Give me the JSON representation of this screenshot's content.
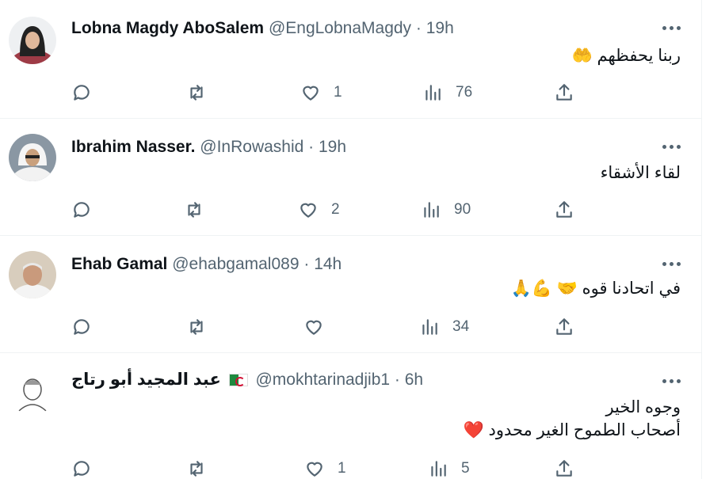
{
  "tweets": [
    {
      "name": "Lobna Magdy AboSalem",
      "handle": "@EngLobnaMagdy",
      "time": "19h",
      "text": "ربنا يحفظهم 🤲",
      "likes": "1",
      "views": "76",
      "avatar_color": "#9e3b46"
    },
    {
      "name": "Ibrahim Nasser.",
      "handle": "@InRowashid",
      "time": "19h",
      "text": "لقاء الأشقاء",
      "likes": "2",
      "views": "90",
      "avatar_color": "#8a97a3"
    },
    {
      "name": "Ehab Gamal",
      "handle": "@ehabgamal089",
      "time": "14h",
      "text": "في اتحادنا قوه 🤝 💪🙏",
      "likes": "",
      "views": "34",
      "avatar_color": "#c7b7a3"
    },
    {
      "name": "عبد المجيد أبو رتاج",
      "handle": "@mokhtarinadjib1",
      "time": "6h",
      "text_line1": "وجوه الخير",
      "text_line2": "أصحاب الطموح الغير محدود ❤️",
      "likes": "1",
      "views": "5",
      "avatar_color": "#e6e6e6"
    }
  ],
  "separator": "·",
  "icons": [
    "reply-icon",
    "retweet-icon",
    "like-icon",
    "views-icon",
    "share-icon",
    "more-icon"
  ],
  "colors": {
    "text": "#0f1419",
    "secondary": "#536471",
    "border": "#eff3f4"
  }
}
